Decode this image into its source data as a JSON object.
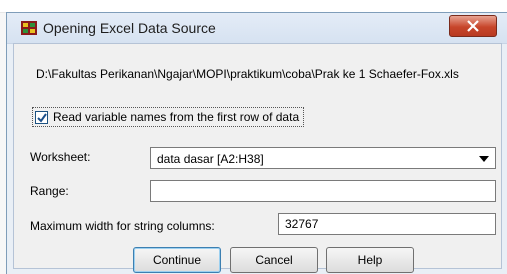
{
  "dialog": {
    "title": "Opening Excel Data Source",
    "file_path": "D:\\Fakultas Perikanan\\Ngajar\\MOPI\\praktikum\\coba\\Prak ke 1 Schaefer-Fox.xls"
  },
  "options": {
    "read_names_label": "Read variable names from the first row of data",
    "read_names_checked": true
  },
  "worksheet": {
    "label": "Worksheet:",
    "selected": "data dasar [A2:H38]"
  },
  "range": {
    "label": "Range:",
    "value": ""
  },
  "max_width": {
    "label": "Maximum width for string columns:",
    "value": "32767"
  },
  "buttons": {
    "continue": "Continue",
    "cancel": "Cancel",
    "help": "Help"
  },
  "colors": {
    "close_button": "#c7462b",
    "accent": "#3c7fb1"
  },
  "icons": {
    "app": "spss-app-icon",
    "close": "close-icon",
    "check": "checkmark-icon",
    "dropdown": "chevron-down-icon"
  }
}
